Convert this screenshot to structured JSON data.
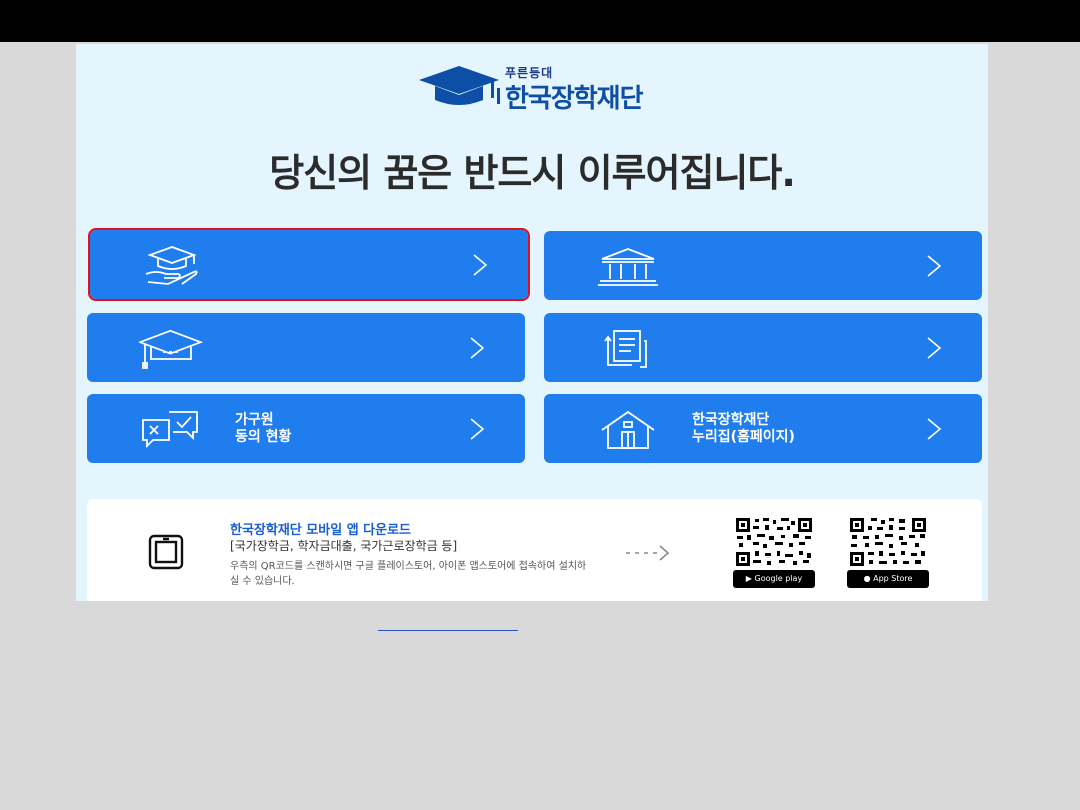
{
  "logo": {
    "small_text": "푸른등대",
    "main_text": "한국장학재단"
  },
  "headline": "당신의 꿈은 반드시 이루어집니다.",
  "menu": [
    {
      "icon": "graduation-cap-hand-icon",
      "lines": [],
      "selected": true
    },
    {
      "icon": "bank-building-icon",
      "lines": [],
      "selected": false
    },
    {
      "icon": "graduation-cap-icon",
      "lines": [],
      "selected": false
    },
    {
      "icon": "documents-icon",
      "lines": [],
      "selected": false
    },
    {
      "icon": "consent-chat-icon",
      "lines": [
        "가구원",
        "동의 현황"
      ],
      "selected": false
    },
    {
      "icon": "house-icon",
      "lines": [
        "한국장학재단",
        "누리집(홈페이지)"
      ],
      "selected": false
    }
  ],
  "app": {
    "title": "한국장학재단 모바일 앱 다운로드",
    "subtitle": "[국가장학금, 학자금대출, 국가근로장학금 등]",
    "description": "우측의 QR코드를 스캔하시면 구글 플레이스토어, 아이폰 앱스토어에 접속하여 설치하실 수 있습니다.",
    "google_play_label": "Google play",
    "app_store_label": "App Store"
  },
  "colors": {
    "button": "#1f7ded",
    "selected_outline": "#e0101c",
    "panel": "#e5f5fd",
    "brand": "#0d4ea6"
  }
}
